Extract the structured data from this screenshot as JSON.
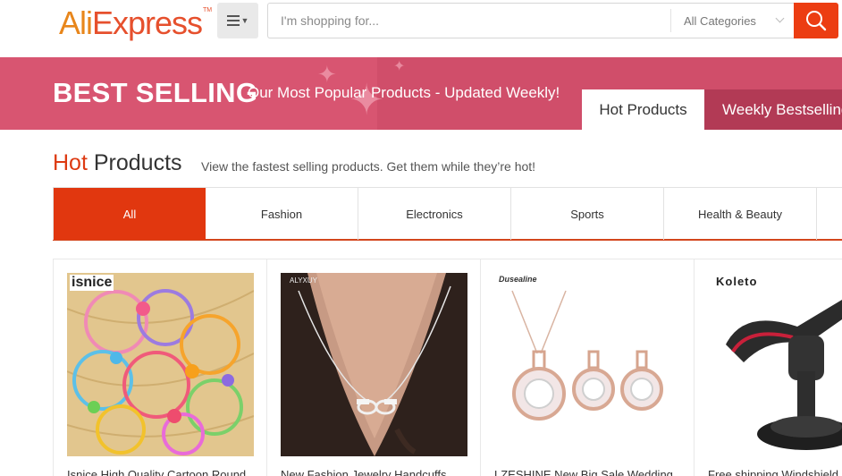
{
  "header": {
    "logo_ali": "Ali",
    "logo_express": "Express",
    "logo_tm": "TM",
    "search_placeholder": "I'm shopping for...",
    "category_label": "All Categories",
    "icons": {
      "menu": "hamburger-icon",
      "search": "search-icon"
    }
  },
  "banner": {
    "title": "BEST SELLING",
    "subtitle": "Our Most Popular Products - Updated Weekly!",
    "tabs": [
      {
        "label": "Hot Products",
        "active": true
      },
      {
        "label": "Weekly Bestselling",
        "active": false
      }
    ]
  },
  "section": {
    "title_hot": "Hot",
    "title_rest": " Products",
    "description": "View the fastest selling products. Get them while they’re hot!"
  },
  "category_tabs": [
    "All",
    "Fashion",
    "Electronics",
    "Sports",
    "Health & Beauty"
  ],
  "products": [
    {
      "brand": "isnice",
      "title": "Isnice High Quality Cartoon Round"
    },
    {
      "brand": "ALYXUY",
      "title": "New Fashion Jewelry Handcuffs"
    },
    {
      "brand": "Dusealine",
      "title": "LZESHINE New Big Sale Wedding"
    },
    {
      "brand": "Koleto",
      "title": "Free shipping Windshield"
    }
  ],
  "colors": {
    "accent": "#e1370f",
    "banner": "#d85571",
    "banner_tab_dark": "#b23a55"
  }
}
